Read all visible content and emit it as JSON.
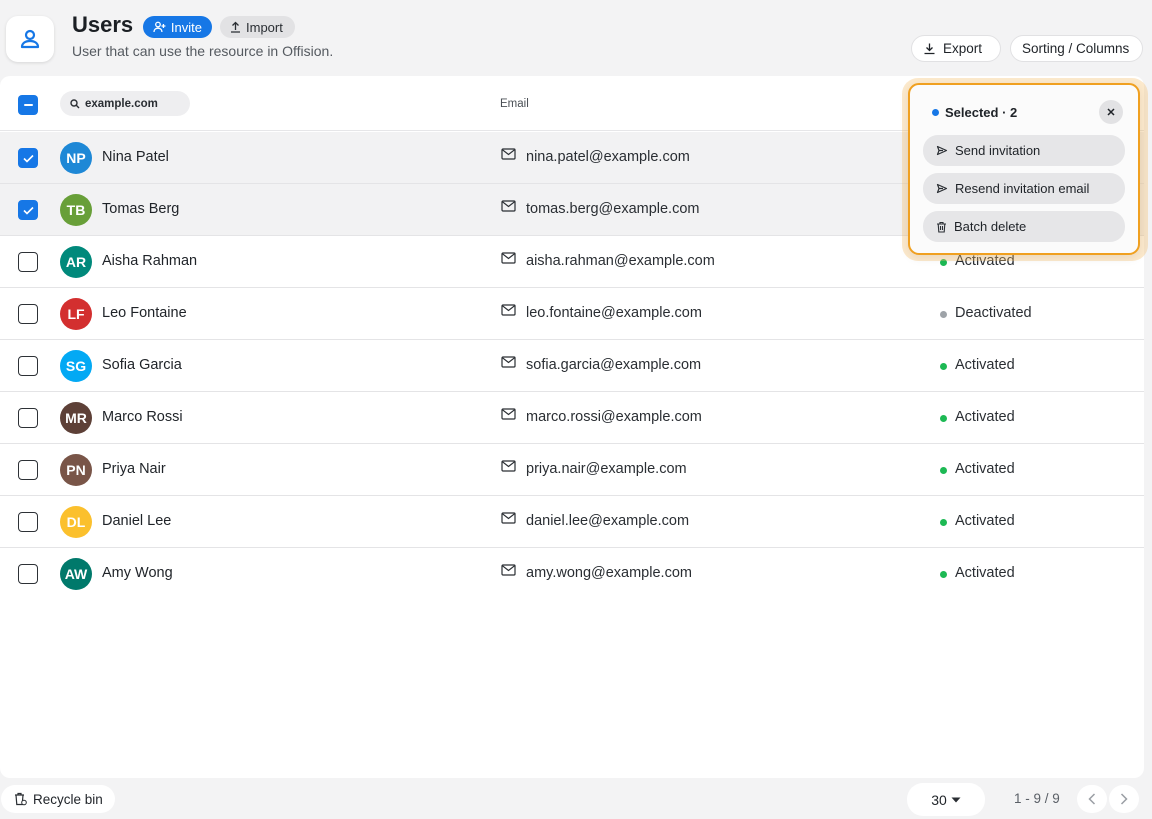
{
  "header": {
    "title": "Users",
    "subtitle": "User that can use the resource in Offision.",
    "invite_label": "Invite",
    "import_label": "Import",
    "export_label": "Export",
    "sorting_label": "Sorting / Columns"
  },
  "table": {
    "search_value": "example.com",
    "email_header": "Email",
    "rows": [
      {
        "initials": "NP",
        "name": "Nina Patel",
        "email": "nina.patel@example.com",
        "status": "",
        "checked": true,
        "avatar_color": "#1e88d6"
      },
      {
        "initials": "TB",
        "name": "Tomas Berg",
        "email": "tomas.berg@example.com",
        "status": "",
        "checked": true,
        "avatar_color": "#689f38"
      },
      {
        "initials": "AR",
        "name": "Aisha Rahman",
        "email": "aisha.rahman@example.com",
        "status": "Activated",
        "checked": false,
        "avatar_color": "#00897b"
      },
      {
        "initials": "LF",
        "name": "Leo Fontaine",
        "email": "leo.fontaine@example.com",
        "status": "Deactivated",
        "checked": false,
        "avatar_color": "#d32f2f"
      },
      {
        "initials": "SG",
        "name": "Sofia Garcia",
        "email": "sofia.garcia@example.com",
        "status": "Activated",
        "checked": false,
        "avatar_color": "#03a9f4"
      },
      {
        "initials": "MR",
        "name": "Marco Rossi",
        "email": "marco.rossi@example.com",
        "status": "Activated",
        "checked": false,
        "avatar_color": "#5d4037"
      },
      {
        "initials": "PN",
        "name": "Priya Nair",
        "email": "priya.nair@example.com",
        "status": "Activated",
        "checked": false,
        "avatar_color": "#795548"
      },
      {
        "initials": "DL",
        "name": "Daniel Lee",
        "email": "daniel.lee@example.com",
        "status": "Activated",
        "checked": false,
        "avatar_color": "#fbc02d"
      },
      {
        "initials": "AW",
        "name": "Amy Wong",
        "email": "amy.wong@example.com",
        "status": "Activated",
        "checked": false,
        "avatar_color": "#00796b"
      }
    ]
  },
  "popup": {
    "selected_label": "Selected · 2",
    "actions": [
      {
        "label": "Send invitation",
        "icon": "send-icon"
      },
      {
        "label": "Resend invitation email",
        "icon": "send-icon"
      },
      {
        "label": "Batch delete",
        "icon": "trash-icon"
      }
    ]
  },
  "footer": {
    "recycle_label": "Recycle bin",
    "per_page": "30",
    "page_info": "1 - 9 / 9"
  },
  "colors": {
    "accent": "#1677e6",
    "highlight": "#f0a020",
    "activated": "#1db954",
    "deactivated": "#9ea3a8"
  }
}
